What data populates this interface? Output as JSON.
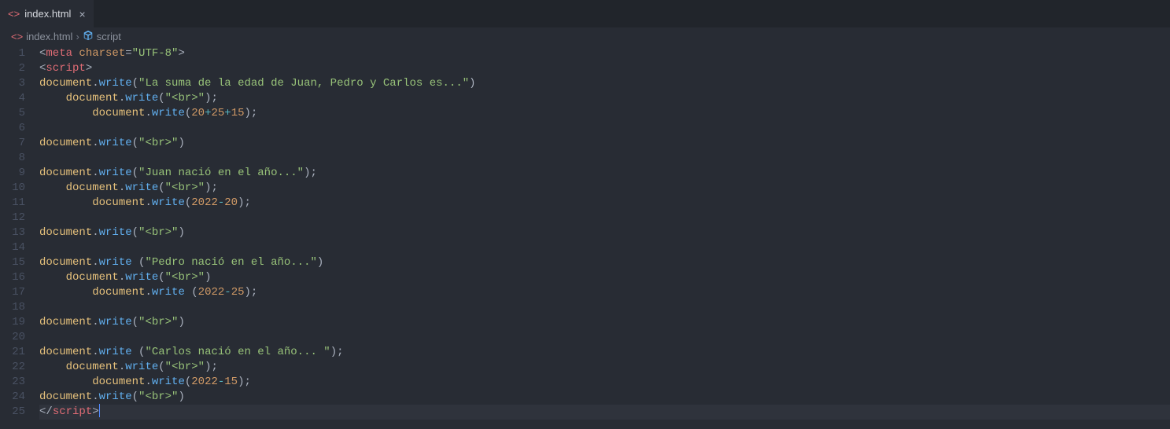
{
  "tab": {
    "filename": "index.html"
  },
  "breadcrumbs": {
    "filename": "index.html",
    "symbol": "script"
  },
  "lineCount": 25,
  "code": {
    "l1": {
      "tag": "meta",
      "attr": "charset",
      "val": "\"UTF-8\""
    },
    "l2": {
      "tag": "script"
    },
    "l3": {
      "obj": "document",
      "fn": "write",
      "str": "\"La suma de la edad de Juan, Pedro y Carlos es...\""
    },
    "l4": {
      "obj": "document",
      "fn": "write",
      "str": "\"<br>\""
    },
    "l5": {
      "obj": "document",
      "fn": "write",
      "n1": "20",
      "op1": "+",
      "n2": "25",
      "op2": "+",
      "n3": "15"
    },
    "l7": {
      "obj": "document",
      "fn": "write",
      "str": "\"<br>\""
    },
    "l9": {
      "obj": "document",
      "fn": "write",
      "str": "\"Juan nació en el año...\""
    },
    "l10": {
      "obj": "document",
      "fn": "write",
      "str": "\"<br>\""
    },
    "l11": {
      "obj": "document",
      "fn": "write",
      "n1": "2022",
      "op1": "-",
      "n2": "20"
    },
    "l13": {
      "obj": "document",
      "fn": "write",
      "str": "\"<br>\""
    },
    "l15": {
      "obj": "document",
      "fn": "write",
      "str": "\"Pedro nació en el año...\""
    },
    "l16": {
      "obj": "document",
      "fn": "write",
      "str": "\"<br>\""
    },
    "l17": {
      "obj": "document",
      "fn": "write",
      "n1": "2022",
      "op1": "-",
      "n2": "25"
    },
    "l19": {
      "obj": "document",
      "fn": "write",
      "str": "\"<br>\""
    },
    "l21": {
      "obj": "document",
      "fn": "write",
      "str": "\"Carlos nació en el año... \""
    },
    "l22": {
      "obj": "document",
      "fn": "write",
      "str": "\"<br>\""
    },
    "l23": {
      "obj": "document",
      "fn": "write",
      "n1": "2022",
      "op1": "-",
      "n2": "15"
    },
    "l24": {
      "obj": "document",
      "fn": "write",
      "str": "\"<br>\""
    },
    "l25": {
      "tag": "script"
    }
  }
}
